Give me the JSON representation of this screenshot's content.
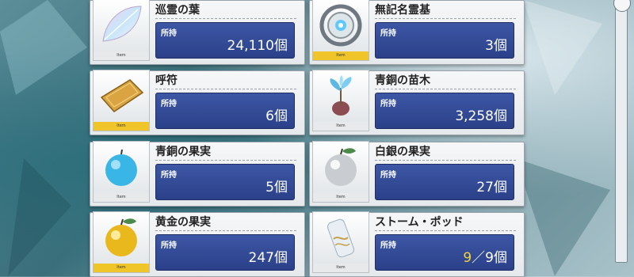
{
  "owned_label": "所持",
  "item_tag": "Item",
  "items": [
    {
      "name": "巡霊の葉",
      "count": "24,110個",
      "frame": "silver",
      "icon": "prism-leaf-icon"
    },
    {
      "name": "無記名霊基",
      "count": "3個",
      "frame": "gold",
      "icon": "saint-quartz-ring-icon"
    },
    {
      "name": "呼符",
      "count": "6個",
      "frame": "gold",
      "icon": "summon-ticket-icon"
    },
    {
      "name": "青銅の苗木",
      "count": "3,258個",
      "frame": "silver",
      "icon": "bronze-sapling-icon"
    },
    {
      "name": "青銅の果実",
      "count": "5個",
      "frame": "silver",
      "icon": "bronze-fruit-icon"
    },
    {
      "name": "白銀の果実",
      "count": "27個",
      "frame": "silver",
      "icon": "silver-fruit-icon"
    },
    {
      "name": "黄金の果実",
      "count": "247個",
      "frame": "gold",
      "icon": "gold-fruit-icon"
    },
    {
      "name": "ストーム・ポッド",
      "count_current": "9",
      "count_rest": "／9個",
      "frame": "silver",
      "icon": "storm-pod-icon"
    }
  ],
  "colors": {
    "own_panel": "#3049a0",
    "gold_tag": "#f0c52a",
    "highlight": "#f5d33a"
  }
}
